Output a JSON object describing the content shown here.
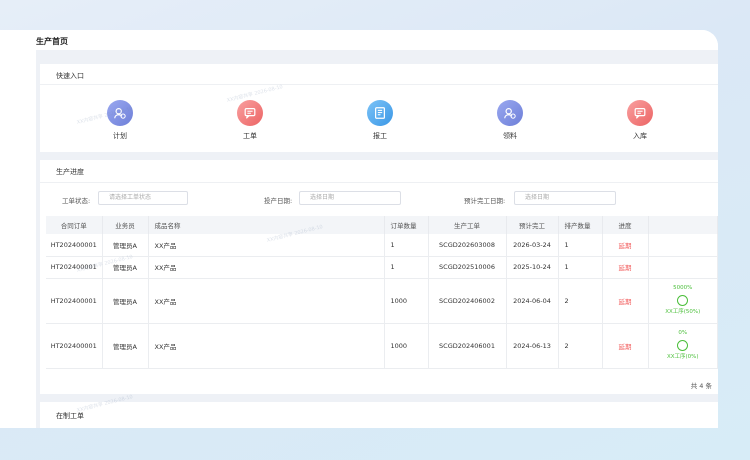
{
  "page": {
    "title": "生产首页"
  },
  "quick_entry": {
    "title": "快速入口",
    "items": [
      {
        "label": "计划",
        "icon": "person-plan-icon",
        "color": "#7b8fe0"
      },
      {
        "label": "工单",
        "icon": "chat-order-icon",
        "color": "#f47b7b"
      },
      {
        "label": "报工",
        "icon": "report-doc-icon",
        "color": "#4aa8ee"
      },
      {
        "label": "领料",
        "icon": "person-material-icon",
        "color": "#7b8fe0"
      },
      {
        "label": "入库",
        "icon": "chat-storage-icon",
        "color": "#f47b7b"
      }
    ]
  },
  "progress": {
    "title": "生产进度",
    "filters": {
      "status_label": "工单状态:",
      "status_placeholder": "请选择工单状态",
      "start_label": "投产日期:",
      "start_placeholder": "选择日期",
      "finish_label": "预计完工日期:",
      "finish_placeholder": "选择日期"
    },
    "columns": [
      "合同订单",
      "业务员",
      "成品名称",
      "订单数量",
      "生产工单",
      "预计完工",
      "排产数量",
      "进度",
      ""
    ],
    "rows": [
      {
        "contract": "HT202400001",
        "salesman": "管理员A",
        "product": "XX产品",
        "qty": "1",
        "order": "SCGD202603008",
        "finish": "2026-03-24",
        "sched": "1",
        "status": "延期",
        "pct": "",
        "proc": ""
      },
      {
        "contract": "HT202400001",
        "salesman": "管理员A",
        "product": "XX产品",
        "qty": "1",
        "order": "SCGD202510006",
        "finish": "2025-10-24",
        "sched": "1",
        "status": "延期",
        "pct": "",
        "proc": ""
      },
      {
        "contract": "HT202400001",
        "salesman": "管理员A",
        "product": "XX产品",
        "qty": "1000",
        "order": "SCGD202406002",
        "finish": "2024-06-04",
        "sched": "2",
        "status": "延期",
        "pct": "5000%",
        "proc": "XX工序(50%)"
      },
      {
        "contract": "HT202400001",
        "salesman": "管理员A",
        "product": "XX产品",
        "qty": "1000",
        "order": "SCGD202406001",
        "finish": "2024-06-13",
        "sched": "2",
        "status": "延期",
        "pct": "0%",
        "proc": "XX工序(0%)"
      }
    ],
    "total": "共 4 条"
  },
  "wip": {
    "title": "在制工单"
  },
  "watermark": "XX内容共享 2026-08-10"
}
